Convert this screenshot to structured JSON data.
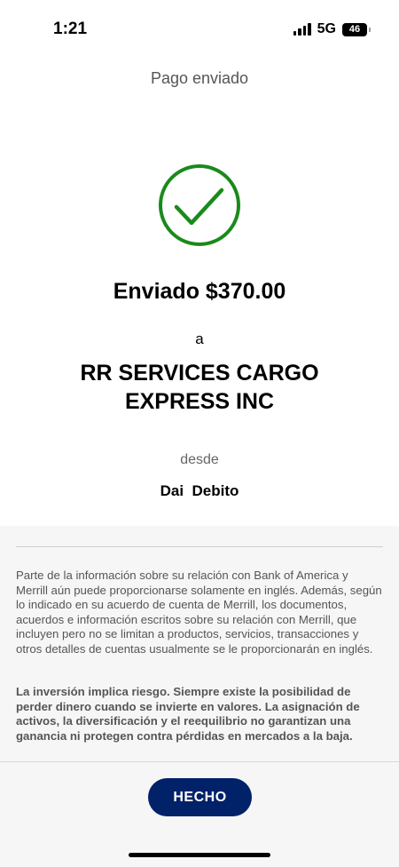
{
  "status_bar": {
    "time": "1:21",
    "network": "5G",
    "battery": "46"
  },
  "header": {
    "title": "Pago enviado"
  },
  "confirmation": {
    "icon": "check-circle-icon",
    "accent_color": "#1a8a1a",
    "amount_text": "Enviado $370.00",
    "to_label": "a",
    "recipient": "RR SERVICES CARGO EXPRESS INC",
    "from_label": "desde",
    "account": "Dai  Debito"
  },
  "disclosure": {
    "language_notice": "Parte de la información sobre su relación con Bank of America y Merrill aún puede proporcionarse solamente en inglés. Además, según lo indicado en su acuerdo de cuenta de Merrill, los documentos, acuerdos e información escritos sobre su relación con Merrill, que incluyen pero no se limitan a productos, servicios, transacciones y otros detalles de cuentas usualmente se le proporcionarán en inglés.",
    "risk_notice": "La inversión implica riesgo. Siempre existe la posibilidad de perder dinero cuando se invierte en valores. La asignación de activos, la diversificación y el reequilibrio no garantizan una ganancia ni protegen contra pérdidas en mercados a la baja."
  },
  "footer": {
    "done_label": "HECHO",
    "button_color": "#012169"
  }
}
